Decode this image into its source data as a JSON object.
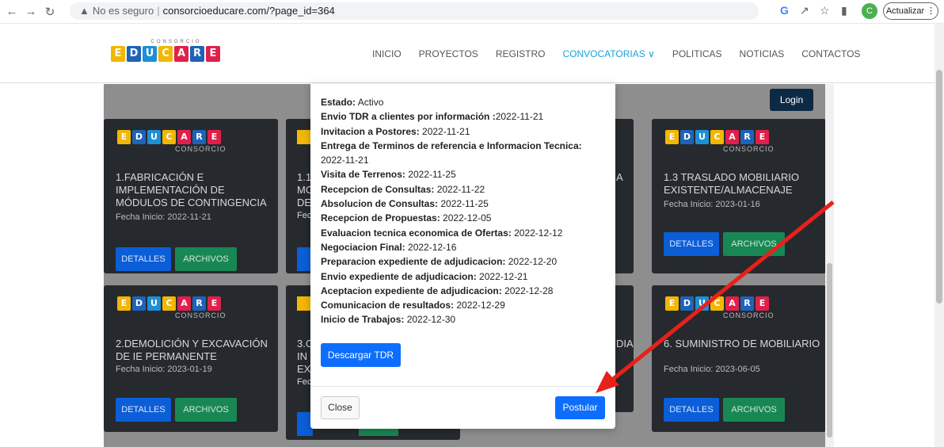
{
  "browser": {
    "url_warning": "No es seguro",
    "url": "consorcioeducare.com/?page_id=364",
    "update_label": "Actualizar",
    "profile_initial": "C"
  },
  "site": {
    "logo_top": "CONSORCIO",
    "logo_letters": [
      "E",
      "D",
      "U",
      "C",
      "A",
      "R",
      "E"
    ],
    "logo_colors": [
      "#f2b705",
      "#1e63b8",
      "#1e8fd6",
      "#f2b705",
      "#e0204a",
      "#1e63b8",
      "#e0204a"
    ],
    "menu": [
      "INICIO",
      "PROYECTOS",
      "REGISTRO",
      "CONVOCATORIAS ∨",
      "POLITICAS",
      "NOTICIAS",
      "CONTACTOS"
    ],
    "active_menu": "CONVOCATORIAS ∨",
    "login_label": "Login"
  },
  "cards": [
    {
      "title": "1.FABRICACIÓN E IMPLEMENTACIÓN DE MÓDULOS DE CONTINGENCIA",
      "date": "Fecha Inicio: 2022-11-21"
    },
    {
      "title": "1.3 TRASLADO MOBILIARIO EXISTENTE/ALMACENAJE",
      "date": "Fecha Inicio: 2023-01-16"
    },
    {
      "title": "2.DEMOLICIÓN Y EXCAVACIÓN DE IE PERMANENTE",
      "date": "Fecha Inicio: 2023-01-19"
    },
    {
      "title": "6. SUMINISTRO DE MOBILIARIO",
      "date": "Fecha Inicio: 2023-06-05"
    }
  ],
  "card_sub": "CONSORCIO",
  "card_buttons": {
    "details": "DETALLES",
    "files": "ARCHIVOS"
  },
  "partial_cards": {
    "c1": [
      "1.1",
      "MO",
      "DE",
      "Fec"
    ],
    "c2": [
      "3.C",
      "IN",
      "EX",
      "Fec"
    ],
    "right1": "A",
    "right2": "DIA"
  },
  "modal": {
    "fields": [
      {
        "label": "Estado:",
        "value": " Activo"
      },
      {
        "label": "Envio TDR a clientes por información :",
        "value": "2022-11-21"
      },
      {
        "label": "Invitacion a Postores:",
        "value": " 2022-11-21"
      },
      {
        "label": "Entrega de Terminos de referencia e Informacion Tecnica:",
        "value": " 2022-11-21"
      },
      {
        "label": "Visita de Terrenos:",
        "value": " 2022-11-25"
      },
      {
        "label": "Recepcion de Consultas:",
        "value": " 2022-11-22"
      },
      {
        "label": "Absolucion de Consultas:",
        "value": " 2022-11-25"
      },
      {
        "label": "Recepcion de Propuestas:",
        "value": " 2022-12-05"
      },
      {
        "label": "Evaluacion tecnica economica de Ofertas:",
        "value": " 2022-12-12"
      },
      {
        "label": "Negociacion Final:",
        "value": " 2022-12-16"
      },
      {
        "label": "Preparacion expediente de adjudicacion:",
        "value": " 2022-12-20"
      },
      {
        "label": "Envio expediente de adjudicacion:",
        "value": " 2022-12-21"
      },
      {
        "label": "Aceptacion expediente de adjudicacion:",
        "value": " 2022-12-28"
      },
      {
        "label": "Comunicacion de resultados:",
        "value": " 2022-12-29"
      },
      {
        "label": "Inicio de Trabajos:",
        "value": " 2022-12-30"
      }
    ],
    "download_label": "Descargar TDR",
    "close_label": "Close",
    "apply_label": "Postular"
  },
  "annotation": {
    "color": "#e8201a"
  }
}
